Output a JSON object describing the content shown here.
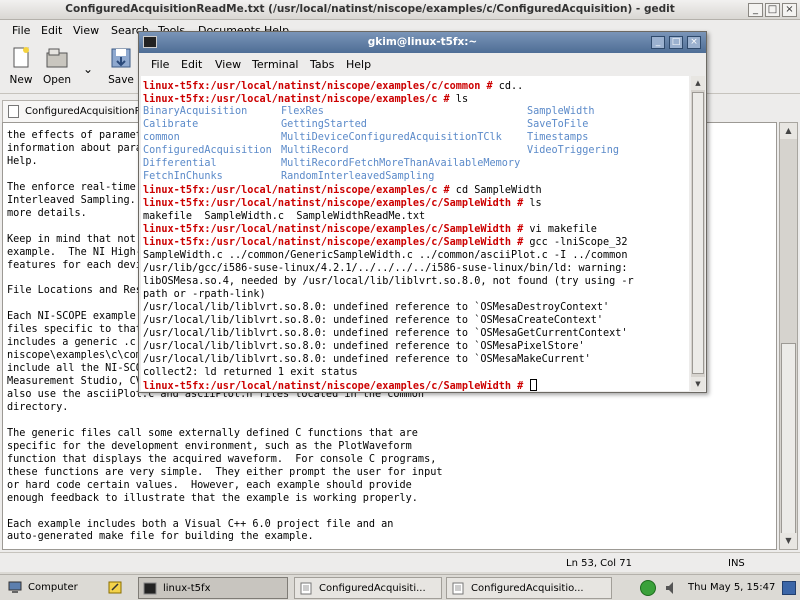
{
  "gedit": {
    "title": "ConfiguredAcquisitionReadMe.txt (/usr/local/natinst/niscope/examples/c/ConfiguredAcquisition) - gedit",
    "menu": [
      "File",
      "Edit",
      "View",
      "Search",
      "Tools",
      "Documents",
      "Help"
    ],
    "toolbar": {
      "new": "New",
      "open": "Open",
      "save": "Save"
    },
    "tab": "ConfiguredAcquisitionReadMe.txt",
    "lines": [
      "the effects of paramet",
      "information about para",
      "Help.",
      "",
      "The enforce real-time",
      "Interleaved Sampling.",
      "more details.",
      "",
      "Keep in mind that not",
      "example.  The NI High-",
      "features for each devi",
      "",
      "File Locations and Res",
      "",
      "Each NI-SCOPE example",
      "files specific to that",
      "includes a generic .c",
      "niscope\\examples\\c\\com",
      "include all the NI-SCO",
      "Measurement Studio, CV",
      "also use the asciiPlot.c and asciiPlot.h files located in the common",
      "directory.",
      "",
      "The generic files call some externally defined C functions that are",
      "specific for the development environment, such as the PlotWaveform",
      "function that displays the acquired waveform.  For console C programs,",
      "these functions are very simple.  They either prompt the user for input",
      "or hard code certain values.  However, each example should provide",
      "enough feedback to illustrate that the example is working properly.",
      "",
      "Each example includes both a Visual C++ 6.0 project file and an",
      "auto-generated make file for building the example."
    ],
    "status": {
      "position": "Ln 53, Col 71",
      "mode": "INS"
    }
  },
  "terminal": {
    "title": "gkim@linux-t5fx:~",
    "menu": [
      "File",
      "Edit",
      "View",
      "Terminal",
      "Tabs",
      "Help"
    ],
    "prompts": {
      "common": "linux-t5fx:/usr/local/natinst/niscope/examples/c/common #",
      "c": "linux-t5fx:/usr/local/natinst/niscope/examples/c #",
      "sw": "linux-t5fx:/usr/local/natinst/niscope/examples/c/SampleWidth #"
    },
    "commands": {
      "cd_up": " cd..",
      "ls1": " ls",
      "cd_sw": " cd SampleWidth",
      "ls2": " ls",
      "vi": " vi makefile",
      "gcc": " gcc -lniScope_32"
    },
    "dirs": [
      [
        "BinaryAcquisition",
        "FlexRes",
        "SampleWidth"
      ],
      [
        "Calibrate",
        "GettingStarted",
        "SaveToFile"
      ],
      [
        "common",
        "MultiDeviceConfiguredAcquisitionTClk",
        "Timestamps"
      ],
      [
        "ConfiguredAcquisition",
        "MultiRecord",
        "VideoTriggering"
      ],
      [
        "Differential",
        "MultiRecordFetchMoreThanAvailableMemory",
        ""
      ],
      [
        "FetchInChunks",
        "RandomInterleavedSampling",
        ""
      ]
    ],
    "output": [
      "makefile  SampleWidth.c  SampleWidthReadMe.txt",
      "SampleWidth.c ../common/GenericSampleWidth.c ../common/asciiPlot.c -I ../common",
      "/usr/lib/gcc/i586-suse-linux/4.2.1/../../../../i586-suse-linux/bin/ld: warning:",
      "libOSMesa.so.4, needed by /usr/local/lib/liblvrt.so.8.0, not found (try using -r",
      "path or -rpath-link)",
      "/usr/local/lib/liblvrt.so.8.0: undefined reference to `OSMesaDestroyContext'",
      "/usr/local/lib/liblvrt.so.8.0: undefined reference to `OSMesaCreateContext'",
      "/usr/local/lib/liblvrt.so.8.0: undefined reference to `OSMesaGetCurrentContext'",
      "/usr/local/lib/liblvrt.so.8.0: undefined reference to `OSMesaPixelStore'",
      "/usr/local/lib/liblvrt.so.8.0: undefined reference to `OSMesaMakeCurrent'",
      "collect2: ld returned 1 exit status"
    ]
  },
  "taskbar": {
    "computer": "Computer",
    "tasks": [
      "linux-t5fx",
      "ConfiguredAcquisiti...",
      "ConfiguredAcquisitio..."
    ],
    "clock": "Thu May 5, 15:47"
  },
  "colors": {
    "prompt": "#cc0000",
    "dir": "#5b8ac9",
    "titlebar": "#4e6d95"
  }
}
